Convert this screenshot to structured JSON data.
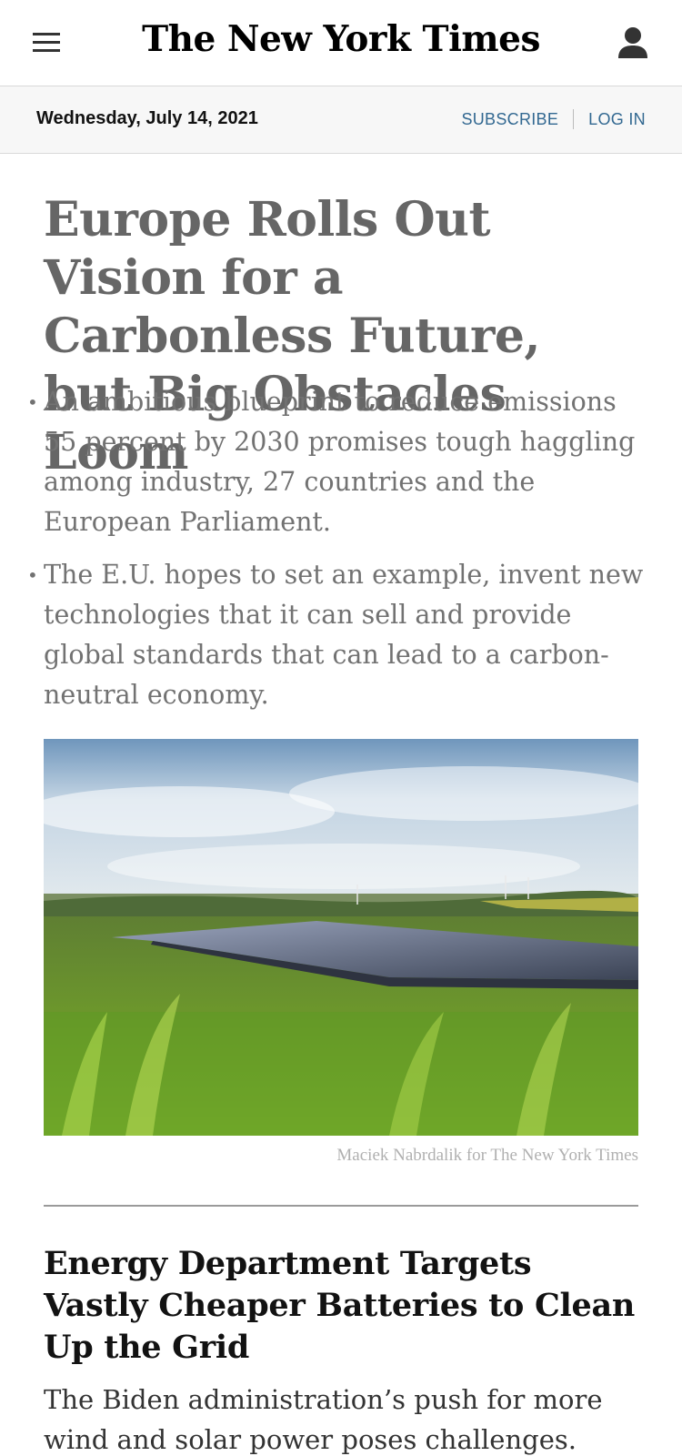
{
  "masthead": {
    "logo_text": "The New York Times",
    "menu_icon": "hamburger-menu-icon",
    "account_icon": "person-icon"
  },
  "datebar": {
    "date": "Wednesday, July 14, 2021",
    "subscribe_label": "SUBSCRIBE",
    "login_label": "LOG IN"
  },
  "lead": {
    "headline": "Europe Rolls Out Vision for a Carbonless Future, but Big Obstacles Loom",
    "summary": [
      "An ambitious blueprint to reduce emissions 55 percent by 2030 promises tough haggling among industry, 27 countries and the European Parliament.",
      "The E.U. hopes to set an example, invent new technologies that it can sell and provide global standards that can lead to a carbon-neutral economy."
    ],
    "photo_credit": "Maciek Nabrdalik for The New York Times"
  },
  "story2": {
    "headline": "Energy Department Targets Vastly Cheaper Batteries to Clean Up the Grid",
    "summary": "The Biden administration’s push for more wind and solar power poses challenges. New"
  },
  "colors": {
    "link_blue": "#326891",
    "headline_gray": "#666666",
    "datebar_bg": "#f7f7f7"
  }
}
